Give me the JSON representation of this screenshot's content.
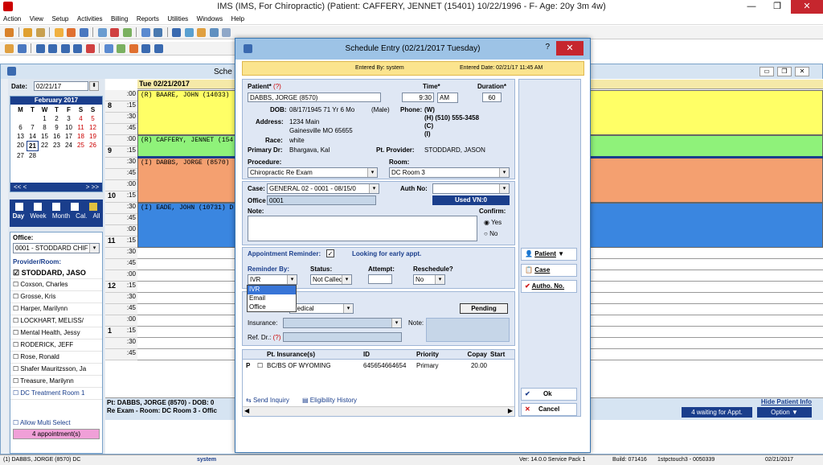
{
  "app": {
    "title": "IMS (IMS, For Chiropractic)     (Patient: CAFFERY, JENNET  (15401) 10/22/1996 - F- Age: 20y 3m 4w)"
  },
  "menu": [
    "Action",
    "View",
    "Setup",
    "Activities",
    "Billing",
    "Reports",
    "Utilities",
    "Windows",
    "Help"
  ],
  "schedule_window": {
    "title": "Sche",
    "date_label": "Date:",
    "date_value": "02/21/17",
    "calendar": {
      "month": "February 2017",
      "weekdays": [
        "M",
        "T",
        "W",
        "T",
        "F",
        "S",
        "S"
      ],
      "weeks": [
        [
          "",
          "",
          "1",
          "2",
          "3",
          "4",
          "5"
        ],
        [
          "6",
          "7",
          "8",
          "9",
          "10",
          "11",
          "12"
        ],
        [
          "13",
          "14",
          "15",
          "16",
          "17",
          "18",
          "19"
        ],
        [
          "20",
          "21",
          "22",
          "23",
          "24",
          "25",
          "26"
        ],
        [
          "27",
          "28",
          "",
          "",
          "",
          "",
          ""
        ]
      ],
      "nav_prev": "<<  <",
      "nav_next": ">  >>"
    },
    "views": [
      "Day",
      "Week",
      "Month",
      "Cal.",
      "All"
    ],
    "office_label": "Office:",
    "office_value": "0001 - STODDARD CHIF",
    "provider_label": "Provider/Room:",
    "providers": [
      "STODDARD, JASO",
      "Coxson, Charles",
      "Grosse, Kris",
      "Harper, Marilynn",
      "LOCKHART, MELISS/",
      "Mental Health, Jessy",
      "RODERICK, JEFF",
      "Rose, Ronald",
      "Shafer Mauritzsson, Ja",
      "Treasure, Marilynn",
      "DC Treatment Room 1"
    ],
    "allow_multi": "Allow Multi Select",
    "appointments_btn": "4 appointment(s)",
    "day_header": "Tue 02/21/2017",
    "hours": [
      {
        "label": "8",
        "ampm": "AM"
      },
      {
        "label": "9",
        "ampm": ""
      },
      {
        "label": "10",
        "ampm": ""
      },
      {
        "label": "11",
        "ampm": ""
      },
      {
        "label": "12",
        "ampm": "PM"
      },
      {
        "label": "1",
        "ampm": ""
      }
    ],
    "minute_marks": [
      ":00",
      ":15",
      ":30",
      ":45"
    ],
    "appointments": [
      {
        "text": "(R)  BAARE, JOHN  (14033)",
        "color": "#ffff66"
      },
      {
        "text": "(R)  CAFFERY, JENNET  (154",
        "color": "#8ff27a"
      },
      {
        "text": "(I)  DABBS, JORGE  (8570)",
        "color": "#f4a070"
      },
      {
        "text": "(I)  EADE, JOHN  (10731)  D",
        "color": "#3a86e0"
      }
    ],
    "footer_line1": "Pt: DABBS, JORGE  (8570) - DOB: 0",
    "footer_line2": "Re Exam - Room: DC Room 3  - Offic",
    "hide_patient": "Hide Patient Info",
    "waiting_btn": "4 waiting for Appt.",
    "option_btn": "Option"
  },
  "dialog": {
    "title": "Schedule Entry (02/21/2017 Tuesday)",
    "help": "?",
    "entered_by": "Entered By: system",
    "entered_date": "Entered Date: 02/21/17 11:45 AM",
    "patient_label": "Patient*",
    "patient_help": "(?)",
    "patient_value": "DABBS, JORGE  (8570)",
    "time_label": "Time*",
    "time_value": "9:30",
    "ampm_value": "AM",
    "duration_label": "Duration*",
    "duration_value": "60",
    "dob_label": "DOB:",
    "dob_value": "08/17/1945  71 Yr 6 Mo",
    "sex_value": "(Male)",
    "phone_label": "Phone:",
    "phone_w": "(W)",
    "phone_h": "(H)  (510) 555-3458",
    "phone_c": "(C)",
    "phone_i": "(I)",
    "address_label": "Address:",
    "address_line1": "1234 Main",
    "address_line2": "Gainesville  MO  65655",
    "race_label": "Race:",
    "race_value": "white",
    "primary_dr_label": "Primary Dr:",
    "primary_dr_value": "Bhargava, Kal",
    "pt_provider_label": "Pt. Provider:",
    "pt_provider_value": "STODDARD, JASON",
    "procedure_label": "Procedure:",
    "procedure_value": "Chiropractic Re Exam",
    "room_label": "Room:",
    "room_value": "DC Room 3",
    "case_label": "Case:",
    "case_value": "GENERAL 02  -  0001 - 08/15/0",
    "auth_label": "Auth No:",
    "office_label": "Office",
    "office_value": "0001",
    "used_vn": "Used VN:0",
    "note_label": "Note:",
    "confirm_label": "Confirm:",
    "confirm_yes": "Yes",
    "confirm_no": "No",
    "reminder_label": "Appointment Reminder:",
    "early_appt": "Looking for early appt.",
    "reminder_by_label": "Reminder By:",
    "reminder_by_value": "IVR",
    "reminder_options": [
      "IVR",
      "Email",
      "Office"
    ],
    "status_label": "Status:",
    "status_value": "Not Called",
    "attempt_label": "Attempt:",
    "reschedule_label": "Reschedule?",
    "reschedule_value": "No",
    "medical_value": "Medical",
    "pending": "Pending",
    "insurance_label": "Insurance:",
    "ins_note_label": "Note:",
    "ref_dr_label": "Ref. Dr.:",
    "ref_dr_help": "(?)",
    "ins_table": {
      "headers": [
        "Pt. Insurance(s)",
        "ID",
        "Priority",
        "Copay",
        "Start"
      ],
      "rows": [
        {
          "flag": "P",
          "name": "BC/BS OF WYOMING",
          "id": "645654664654",
          "priority": "Primary",
          "copay": "20.00",
          "start": ""
        }
      ]
    },
    "send_inquiry": "Send Inquiry",
    "eligibility_history": "Eligibility History",
    "btn_patient": "Patient",
    "btn_case": "Case",
    "btn_autho": "Autho. No.",
    "btn_ok": "Ok",
    "btn_cancel": "Cancel"
  },
  "statusbar": {
    "patient": "(1)  DABBS, JORGE  (8570)  DC",
    "user": "system",
    "version": "Ver: 14.0.0 Service Pack 1",
    "build": "Build: 071416",
    "station": "1stpctouch3 - 0050339",
    "date": "02/21/2017"
  }
}
